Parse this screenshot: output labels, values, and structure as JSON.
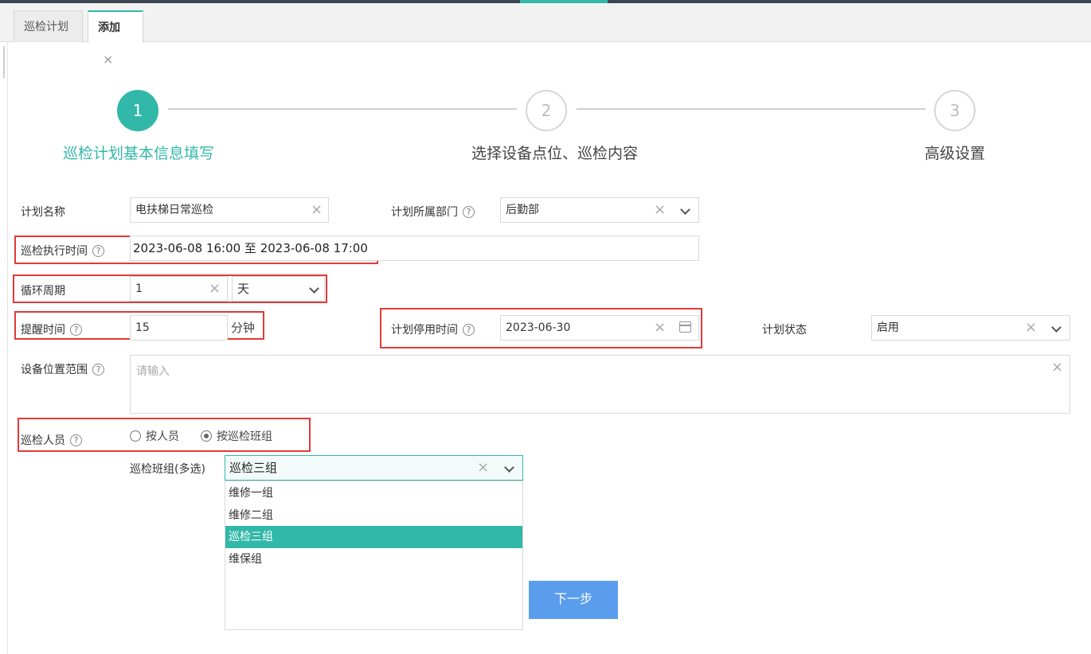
{
  "tabs": [
    {
      "label": "巡检计划",
      "active": false
    },
    {
      "label": "添加",
      "active": true,
      "close": "×"
    }
  ],
  "steps": [
    {
      "number": "1",
      "label": "巡检计划基本信息填写",
      "active": true
    },
    {
      "number": "2",
      "label": "选择设备点位、巡检内容",
      "active": false
    },
    {
      "number": "3",
      "label": "高级设置",
      "active": false
    }
  ],
  "help_glyph": "?",
  "clear_glyph": "×",
  "form": {
    "plan_name": {
      "label": "计划名称",
      "value": "电扶梯日常巡检"
    },
    "department": {
      "label": "计划所属部门",
      "value": "后勤部"
    },
    "exec_time": {
      "label": "巡检执行时间",
      "value": "2023-06-08 16:00 至 2023-06-08 17:00"
    },
    "cycle": {
      "label": "循环周期",
      "value": "1",
      "unit_value": "天"
    },
    "reminder": {
      "label": "提醒时间",
      "value": "15",
      "unit": "分钟"
    },
    "stop_time": {
      "label": "计划停用时间",
      "value": "2023-06-30"
    },
    "status": {
      "label": "计划状态",
      "value": "启用"
    },
    "location": {
      "label": "设备位置范围",
      "placeholder": "请输入"
    },
    "inspector": {
      "label": "巡检人员",
      "options": [
        {
          "label": "按人员",
          "checked": false
        },
        {
          "label": "按巡检班组",
          "checked": true
        }
      ]
    },
    "team": {
      "label": "巡检班组(多选)",
      "value": "巡检三组",
      "options": [
        "维修一组",
        "维修二组",
        "巡检三组",
        "维保组"
      ],
      "selected": "巡检三组"
    }
  },
  "next_button": "下一步",
  "colors": {
    "accent": "#31b8a8",
    "highlight": "#e23a3a",
    "button": "#5b9ded"
  }
}
